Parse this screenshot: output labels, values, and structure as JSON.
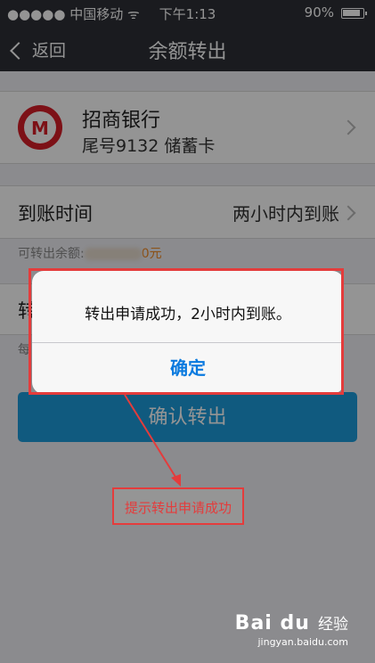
{
  "status_bar": {
    "carrier": "●●●●● 中国移动 ᯤ",
    "time": "下午1:13",
    "battery": "90%"
  },
  "nav": {
    "back_label": "返回",
    "title": "余额转出"
  },
  "bank": {
    "name": "招商银行",
    "card": "尾号9132 储蓄卡"
  },
  "arrival": {
    "label": "到账时间",
    "value": "两小时内到账"
  },
  "available": {
    "prefix": "可转出余额:",
    "amount_suffix": "0元"
  },
  "amount_row": {
    "label": "转"
  },
  "hint_row": {
    "label": "每"
  },
  "confirm_button": "确认转出",
  "alert": {
    "message": "转出申请成功，2小时内到账。",
    "button": "确定"
  },
  "annotation": {
    "text": "提示转出申请成功"
  },
  "watermark": {
    "brand": "Bai  du",
    "suffix": "经验",
    "url": "jingyan.baidu.com"
  },
  "colors": {
    "nav_bg": "#2e3036",
    "primary_button": "#1c9bdb",
    "alert_button": "#0a7adf",
    "annotation_red": "#e43c3c",
    "amount_orange": "#f08a24"
  }
}
